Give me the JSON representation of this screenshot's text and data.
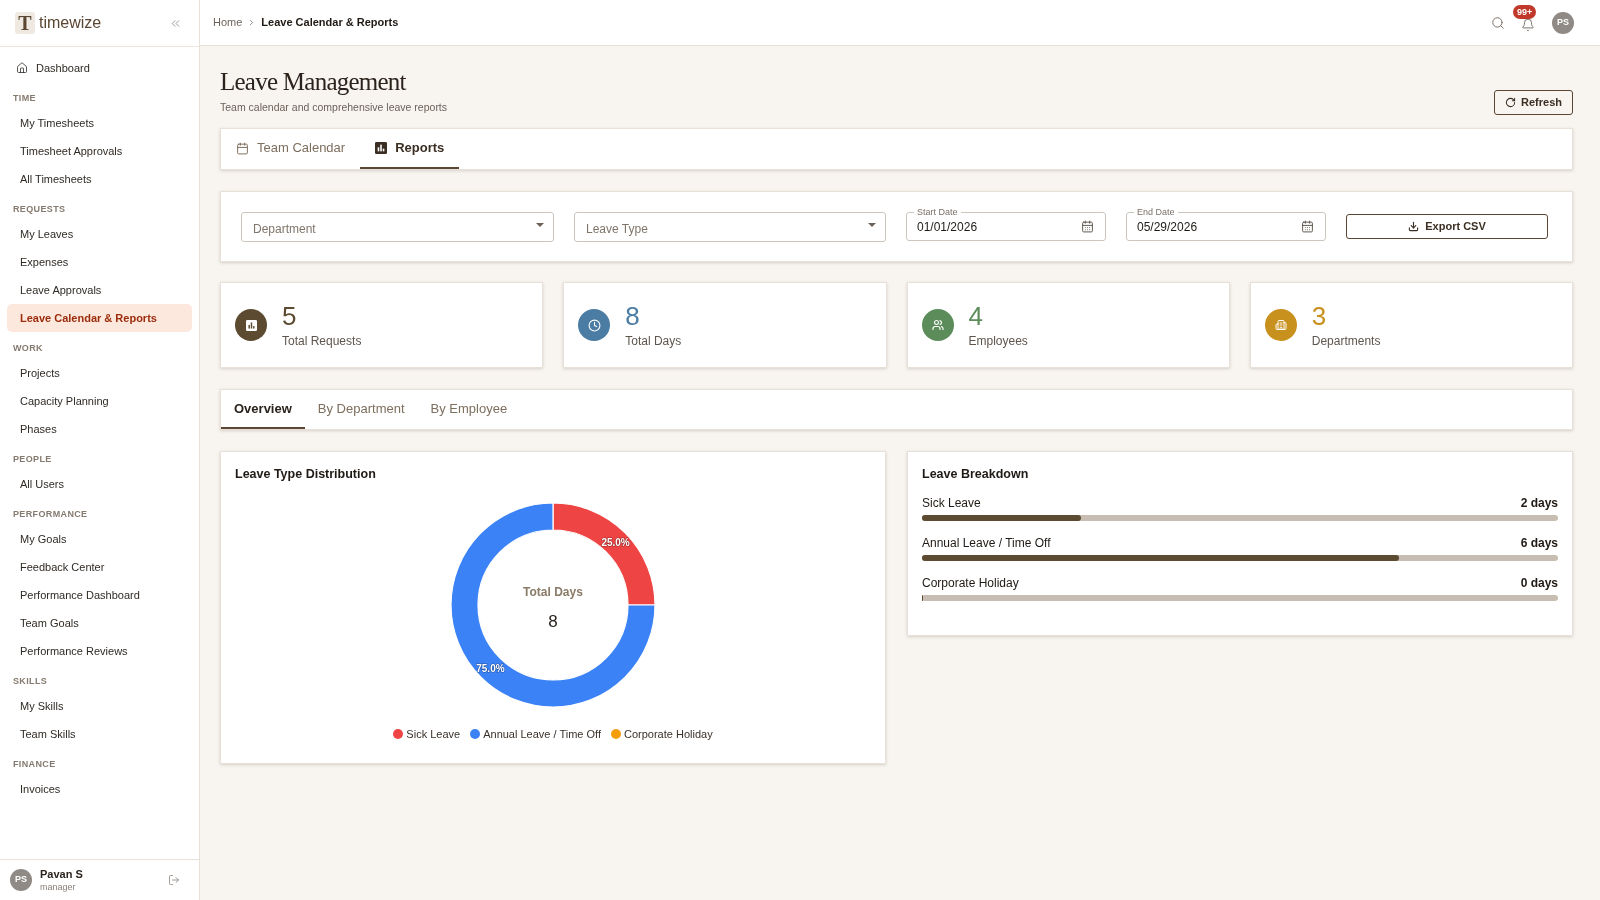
{
  "sidebar": {
    "brand": {
      "mark": "T",
      "name": "timewize"
    },
    "top_item": {
      "label": "Dashboard",
      "selected": false
    },
    "sections": [
      {
        "title": "TIME",
        "items": [
          {
            "label": "My Timesheets",
            "selected": false
          },
          {
            "label": "Timesheet Approvals",
            "selected": false
          },
          {
            "label": "All Timesheets",
            "selected": false
          }
        ]
      },
      {
        "title": "REQUESTS",
        "items": [
          {
            "label": "My Leaves",
            "selected": false
          },
          {
            "label": "Expenses",
            "selected": false
          },
          {
            "label": "Leave Approvals",
            "selected": false
          },
          {
            "label": "Leave Calendar & Reports",
            "selected": true
          }
        ]
      },
      {
        "title": "WORK",
        "items": [
          {
            "label": "Projects",
            "selected": false
          },
          {
            "label": "Capacity Planning",
            "selected": false
          },
          {
            "label": "Phases",
            "selected": false
          }
        ]
      },
      {
        "title": "PEOPLE",
        "items": [
          {
            "label": "All Users",
            "selected": false
          }
        ]
      },
      {
        "title": "PERFORMANCE",
        "items": [
          {
            "label": "My Goals",
            "selected": false
          },
          {
            "label": "Feedback Center",
            "selected": false
          },
          {
            "label": "Performance Dashboard",
            "selected": false
          },
          {
            "label": "Team Goals",
            "selected": false
          },
          {
            "label": "Performance Reviews",
            "selected": false
          }
        ]
      },
      {
        "title": "SKILLS",
        "items": [
          {
            "label": "My Skills",
            "selected": false
          },
          {
            "label": "Team Skills",
            "selected": false
          }
        ]
      },
      {
        "title": "FINANCE",
        "items": [
          {
            "label": "Invoices",
            "selected": false
          }
        ]
      }
    ],
    "user": {
      "initials": "PS",
      "name": "Pavan S",
      "role": "manager"
    }
  },
  "header": {
    "breadcrumb": [
      {
        "label": "Home",
        "current": false
      },
      {
        "label": "Leave Calendar & Reports",
        "current": true
      }
    ],
    "notification_count": "99+",
    "avatar_initials": "PS"
  },
  "page": {
    "title": "Leave Management",
    "subtitle": "Team calendar and comprehensive leave reports",
    "refresh_button": "Refresh"
  },
  "view_tabs": [
    {
      "kind": "calendar",
      "label": "Team Calendar",
      "selected": false
    },
    {
      "kind": "reports",
      "label": "Reports",
      "selected": true
    }
  ],
  "filters": {
    "department": {
      "placeholder": "Department"
    },
    "leave_type": {
      "placeholder": "Leave Type"
    },
    "start_date": {
      "label": "Start Date",
      "value": "01/01/2026"
    },
    "end_date": {
      "label": "End Date",
      "value": "05/29/2026"
    },
    "export_button": "Export CSV"
  },
  "stats": [
    {
      "kind": "requests",
      "value": "5",
      "label": "Total Requests",
      "color": "#5c4a31"
    },
    {
      "kind": "days",
      "value": "8",
      "label": "Total Days",
      "color": "#4b7ca3"
    },
    {
      "kind": "employees",
      "value": "4",
      "label": "Employees",
      "color": "#5b8c5a"
    },
    {
      "kind": "departments",
      "value": "3",
      "label": "Departments",
      "color": "#c8901c"
    }
  ],
  "report_tabs": [
    {
      "label": "Overview",
      "selected": true
    },
    {
      "label": "By Department",
      "selected": false
    },
    {
      "label": "By Employee",
      "selected": false
    }
  ],
  "distribution": {
    "title": "Leave Type Distribution",
    "center_label": "Total Days",
    "center_value": "8",
    "chart_data": {
      "type": "donut",
      "categories": [
        "Sick Leave",
        "Annual Leave / Time Off",
        "Corporate Holiday"
      ],
      "values": [
        25,
        75,
        0
      ],
      "colors": [
        "#ef4444",
        "#3b82f6",
        "#f59e0b"
      ],
      "value_labels": [
        "25.0%",
        "75.0%",
        null
      ],
      "legend": "bottom"
    }
  },
  "breakdown": {
    "title": "Leave Breakdown",
    "rows": [
      {
        "label": "Sick Leave",
        "reading": "2 days",
        "level": 0.25
      },
      {
        "label": "Annual Leave / Time Off",
        "reading": "6 days",
        "level": 0.75
      },
      {
        "label": "Corporate Holiday",
        "reading": "0 days",
        "level": 0
      }
    ]
  }
}
